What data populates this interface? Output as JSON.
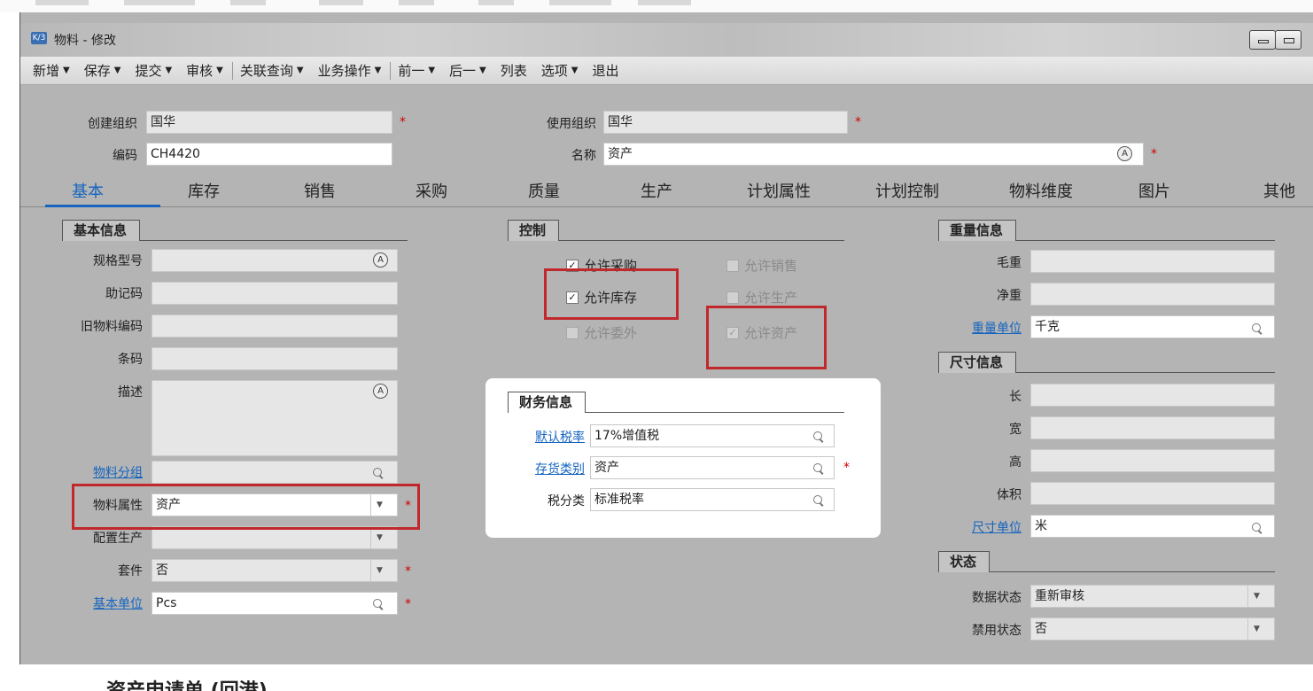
{
  "window": {
    "title": "物料 - 修改",
    "logo": "K/3"
  },
  "toolbar": {
    "items": [
      {
        "label": "新增",
        "arrow": true
      },
      {
        "label": "保存",
        "arrow": true
      },
      {
        "label": "提交",
        "arrow": true
      },
      {
        "label": "审核",
        "arrow": true,
        "sep": true
      },
      {
        "label": "关联查询",
        "arrow": true
      },
      {
        "label": "业务操作",
        "arrow": true,
        "sep": true
      },
      {
        "label": "前一",
        "arrow": true
      },
      {
        "label": "后一",
        "arrow": true
      },
      {
        "label": "列表",
        "arrow": false
      },
      {
        "label": "选项",
        "arrow": true
      },
      {
        "label": "退出",
        "arrow": false
      }
    ]
  },
  "header": {
    "create_org": {
      "label": "创建组织",
      "value": "国华"
    },
    "use_org": {
      "label": "使用组织",
      "value": "国华"
    },
    "code": {
      "label": "编码",
      "value": "CH4420"
    },
    "name": {
      "label": "名称",
      "value": "资产"
    }
  },
  "tabs": [
    "基本",
    "库存",
    "销售",
    "采购",
    "质量",
    "生产",
    "计划属性",
    "计划控制",
    "物料维度",
    "图片",
    "其他"
  ],
  "basic": {
    "title": "基本信息",
    "spec": {
      "label": "规格型号",
      "value": ""
    },
    "mnemonic": {
      "label": "助记码",
      "value": ""
    },
    "old_code": {
      "label": "旧物料编码",
      "value": ""
    },
    "barcode": {
      "label": "条码",
      "value": ""
    },
    "desc": {
      "label": "描述",
      "value": ""
    },
    "group": {
      "label": "物料分组",
      "value": ""
    },
    "attr": {
      "label": "物料属性",
      "value": "资产"
    },
    "config": {
      "label": "配置生产",
      "value": ""
    },
    "kit": {
      "label": "套件",
      "value": "否"
    },
    "unit": {
      "label": "基本单位",
      "value": "Pcs"
    }
  },
  "control": {
    "title": "控制",
    "allow_purchase": "允许采购",
    "allow_sale": "允许销售",
    "allow_stock": "允许库存",
    "allow_produce": "允许生产",
    "allow_outsource": "允许委外",
    "allow_asset": "允许资产"
  },
  "finance": {
    "title": "财务信息",
    "tax_rate": {
      "label": "默认税率",
      "value": "17%增值税"
    },
    "stock_cat": {
      "label": "存货类别",
      "value": "资产"
    },
    "tax_class": {
      "label": "税分类",
      "value": "标准税率"
    }
  },
  "weight": {
    "title": "重量信息",
    "gross": {
      "label": "毛重",
      "value": ""
    },
    "net": {
      "label": "净重",
      "value": ""
    },
    "unit": {
      "label": "重量单位",
      "value": "千克"
    }
  },
  "size": {
    "title": "尺寸信息",
    "length": {
      "label": "长",
      "value": ""
    },
    "width": {
      "label": "宽",
      "value": ""
    },
    "height": {
      "label": "高",
      "value": ""
    },
    "volume": {
      "label": "体积",
      "value": ""
    },
    "unit": {
      "label": "尺寸单位",
      "value": "米"
    }
  },
  "status": {
    "title": "状态",
    "data_status": {
      "label": "数据状态",
      "value": "重新审核"
    },
    "forbid_status": {
      "label": "禁用状态",
      "value": "否"
    }
  },
  "caption": "资产申请单 (回港)",
  "colors": {
    "link": "#1565c0",
    "required": "#d10000",
    "highlight": "#c0282c"
  }
}
